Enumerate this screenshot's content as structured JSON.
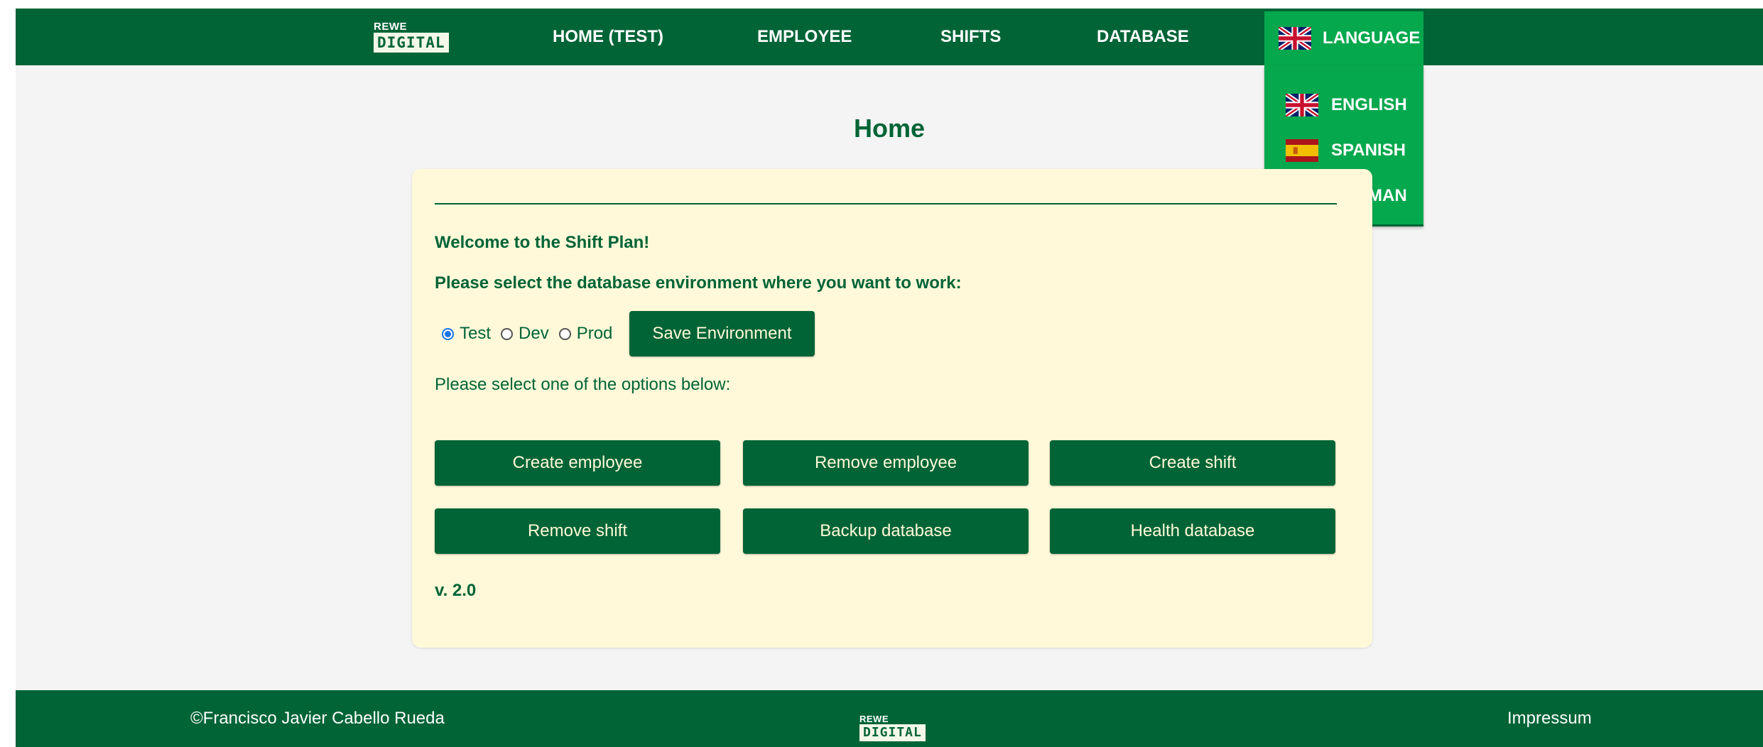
{
  "logo": {
    "top": "REWE",
    "bottom": "DIGITAL"
  },
  "nav": {
    "home": "HOME (TEST)",
    "employee": "EMPLOYEE",
    "shifts": "SHIFTS",
    "database": "DATABASE",
    "language": "LANGUAGE",
    "language_flag": "uk-flag-icon"
  },
  "language_menu": [
    {
      "label": "ENGLISH",
      "icon": "uk-flag-icon"
    },
    {
      "label": "SPANISH",
      "icon": "spain-flag-icon"
    },
    {
      "label": "GERMAN",
      "icon": "germany-flag-icon"
    }
  ],
  "page": {
    "title": "Home"
  },
  "card": {
    "welcome": "Welcome to the Shift Plan!",
    "db_prompt": "Please select the database environment where you want to work:",
    "environments": [
      {
        "label": "Test",
        "checked": true
      },
      {
        "label": "Dev",
        "checked": false
      },
      {
        "label": "Prod",
        "checked": false
      }
    ],
    "save_label": "Save Environment",
    "options_prompt": "Please select one of the options below:",
    "options": [
      "Create employee",
      "Remove employee",
      "Create shift",
      "Remove shift",
      "Backup database",
      "Health database"
    ],
    "version": "v. 2.0"
  },
  "footer": {
    "copyright": "©Francisco Javier Cabello Rueda",
    "impressum": "Impressum"
  },
  "colors": {
    "primary": "#006436",
    "accent": "#06a84d",
    "card_bg": "#fff9d9",
    "page_bg": "#f4f4f4"
  }
}
